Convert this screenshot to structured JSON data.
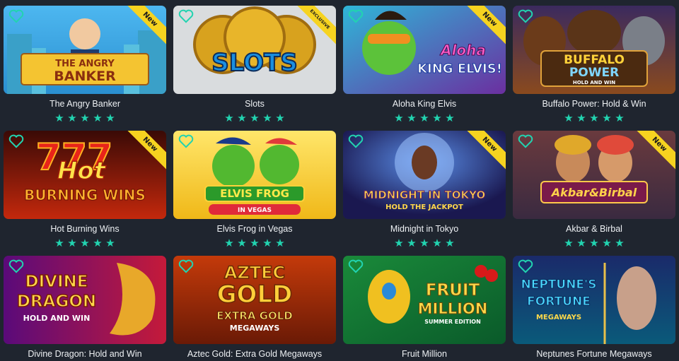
{
  "colors": {
    "background": "#1f252f",
    "accent": "#22d3b0",
    "badge": "#f6d320",
    "text": "#eef1f4"
  },
  "icons": {
    "favorite": "heart-outline-icon",
    "rating": "star-icon"
  },
  "badges": {
    "new_label": "New",
    "exclusive_label": "EXCLUSIVE"
  },
  "games": [
    {
      "title": "The Angry Banker",
      "art_line1": "THE ANGRY",
      "art_line2": "BANKER",
      "rating": 5
    },
    {
      "title": "Slots",
      "art_line1": "SLOTS",
      "rating": 5
    },
    {
      "title": "Aloha King Elvis",
      "art_line1": "Aloha",
      "art_line2": "KING ELVIS!",
      "rating": 5
    },
    {
      "title": "Buffalo Power: Hold & Win",
      "art_line1": "BUFFALO",
      "art_line2": "POWER",
      "art_line3": "HOLD AND WIN",
      "rating": 5
    },
    {
      "title": "Hot Burning Wins",
      "art_line1": "777",
      "art_line2": "Hot",
      "art_line3": "BURNING WINS",
      "rating": 5
    },
    {
      "title": "Elvis Frog in Vegas",
      "art_line1": "ELVIS FROG",
      "art_line2": "IN VEGAS",
      "rating": 5
    },
    {
      "title": "Midnight in Tokyo",
      "art_line1": "MIDNIGHT IN TOKYO",
      "art_line2": "HOLD THE JACKPOT",
      "rating": 5
    },
    {
      "title": "Akbar & Birbal",
      "art_line1": "Akbar&Birbal",
      "rating": 5
    },
    {
      "title": "Divine Dragon: Hold and Win",
      "art_line1": "DIVINE",
      "art_line2": "DRAGON",
      "art_line3": "HOLD AND WIN"
    },
    {
      "title": "Aztec Gold: Extra Gold Megaways",
      "art_line1": "AZTEC",
      "art_line2": "GOLD",
      "art_line3": "EXTRA GOLD",
      "art_line4": "MEGAWAYS"
    },
    {
      "title": "Fruit Million",
      "art_line1": "FRUIT",
      "art_line2": "MILLION",
      "art_line3": "SUMMER EDITION"
    },
    {
      "title": "Neptunes Fortune Megaways",
      "art_line1": "NEPTUNE'S",
      "art_line2": "FORTUNE",
      "art_line3": "MEGAWAYS"
    }
  ]
}
